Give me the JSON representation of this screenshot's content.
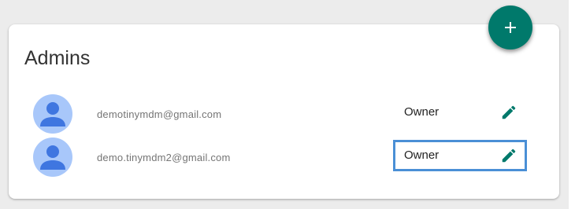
{
  "card": {
    "title": "Admins"
  },
  "add_button": {
    "icon": "plus-icon",
    "color": "#00796b"
  },
  "admins": [
    {
      "email": "demotinymdm@gmail.com",
      "role": "Owner",
      "avatar_icon": "person-icon",
      "edit_icon": "pencil-icon"
    },
    {
      "email": "demo.tinymdm2@gmail.com",
      "role": "Owner",
      "avatar_icon": "person-icon",
      "edit_icon": "pencil-icon",
      "focused": true
    }
  ],
  "colors": {
    "accent": "#00796b",
    "avatar_bg": "#a8c7fa",
    "avatar_fg": "#3f76e0",
    "focus_outline": "#4a8fd6"
  }
}
